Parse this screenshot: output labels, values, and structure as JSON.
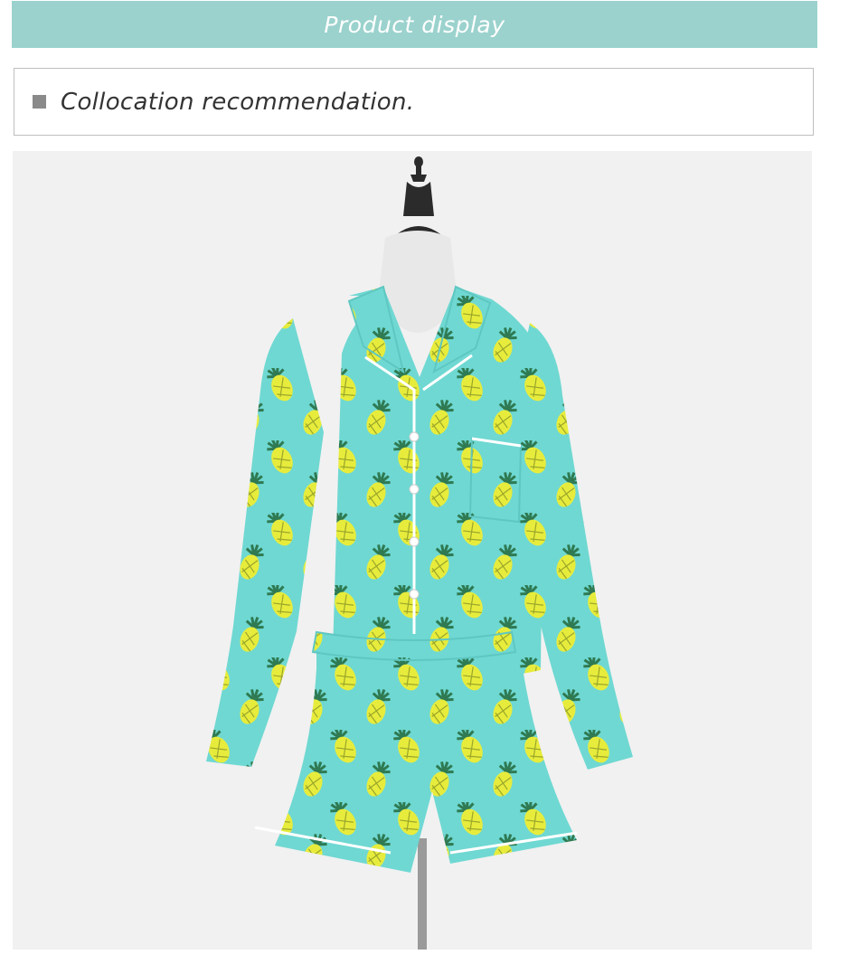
{
  "banner": {
    "title": "Product display"
  },
  "section": {
    "icon": "square-bullet-icon",
    "label": "Collocation recommendation."
  },
  "photo": {
    "subject": "pineapple-print-pajama-set-image",
    "colors": {
      "background": "#f1f1f1",
      "fabric": "#6fd8d2",
      "pineapple": "#e7ec3c",
      "leaf": "#2f7a52",
      "piping": "#ffffff"
    }
  }
}
